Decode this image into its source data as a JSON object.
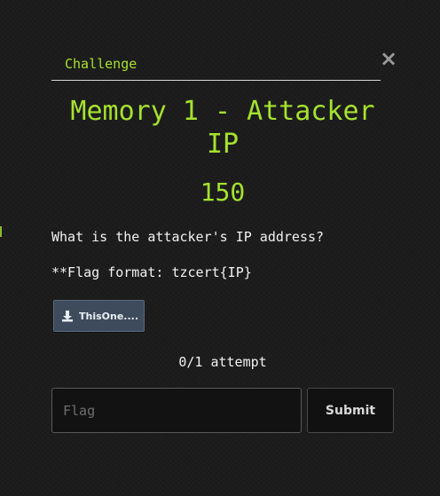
{
  "modal": {
    "tab_label": "Challenge",
    "close_symbol": "×",
    "title": "Memory 1 - Attacker IP",
    "points": "150",
    "description": {
      "question": "What is the attacker's IP address?",
      "flag_format": "**Flag format: tzcert{IP}"
    },
    "file": {
      "icon": "download-icon",
      "label": "ThisOne...."
    },
    "attempts": "0/1 attempt",
    "flag_input": {
      "value": "",
      "placeholder": "Flag"
    },
    "submit_label": "Submit"
  },
  "colors": {
    "accent": "#a6e22e",
    "background": "#1c1c1c",
    "file_button": "#3e4b5c",
    "input_background": "#121212"
  }
}
